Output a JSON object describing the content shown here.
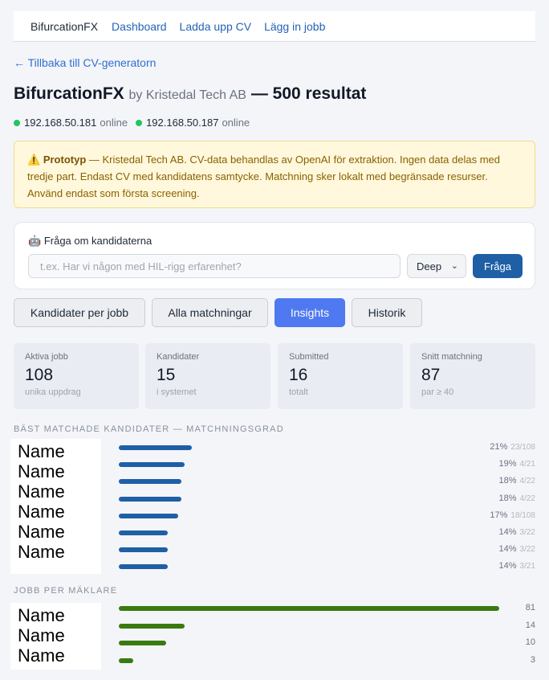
{
  "nav": {
    "brand": "BifurcationFX",
    "links": [
      "Dashboard",
      "Ladda upp CV",
      "Lägg in jobb"
    ]
  },
  "back_link": "← Tillbaka till CV-generatorn",
  "header": {
    "company": "BifurcationFX",
    "by": "by Kristedal Tech AB",
    "results": "— 500 resultat"
  },
  "servers": [
    {
      "host": "192.168.50.181",
      "state": "online"
    },
    {
      "host": "192.168.50.187",
      "state": "online"
    }
  ],
  "warning": {
    "icon": "warning-icon",
    "label": "Prototyp",
    "text": " — Kristedal Tech AB. CV-data behandlas av OpenAI för extraktion. Ingen data delas med tredje part. Endast CV med kandidatens samtycke. Matchning sker lokalt med begränsade resurser. Använd endast som första screening."
  },
  "ask": {
    "title": "Fråga om kandidaterna",
    "icon": "robot-icon",
    "placeholder": "t.ex. Har vi någon med HIL-rigg erfarenhet?",
    "mode": "Deep",
    "button": "Fråga"
  },
  "tabs": [
    {
      "label": "Kandidater per jobb",
      "active": false
    },
    {
      "label": "Alla matchningar",
      "active": false
    },
    {
      "label": "Insights",
      "active": true
    },
    {
      "label": "Historik",
      "active": false
    }
  ],
  "stats": [
    {
      "label": "Aktiva jobb",
      "value": "108",
      "sub": "unika uppdrag"
    },
    {
      "label": "Kandidater",
      "value": "15",
      "sub": "i systemet"
    },
    {
      "label": "Submitted",
      "value": "16",
      "sub": "totalt"
    },
    {
      "label": "Snitt matchning",
      "value": "87",
      "sub": "par ≥ 40"
    }
  ],
  "match_section": {
    "title": "BÄST MATCHADE KANDIDATER — MATCHNINGSGRAD",
    "names": [
      "Name",
      "Name",
      "Name",
      "Name",
      "Name",
      "Name"
    ],
    "rows": [
      {
        "pct": "21%",
        "frac": "23/108",
        "value": 21
      },
      {
        "pct": "19%",
        "frac": "4/21",
        "value": 19
      },
      {
        "pct": "18%",
        "frac": "4/22",
        "value": 18
      },
      {
        "pct": "18%",
        "frac": "4/22",
        "value": 18
      },
      {
        "pct": "17%",
        "frac": "18/108",
        "value": 17
      },
      {
        "pct": "14%",
        "frac": "3/22",
        "value": 14
      },
      {
        "pct": "14%",
        "frac": "3/22",
        "value": 14
      },
      {
        "pct": "14%",
        "frac": "3/21",
        "value": 14
      }
    ]
  },
  "broker_section": {
    "title": "JOBB PER MÄKLARE",
    "names": [
      "Name",
      "Name",
      "Name"
    ],
    "rows": [
      {
        "count": "81",
        "value": 81
      },
      {
        "count": "14",
        "value": 14
      },
      {
        "count": "10",
        "value": 10
      },
      {
        "count": "3",
        "value": 3
      }
    ]
  },
  "colors": {
    "match_bar": "#1f5fa6",
    "broker_bar": "#3a7a10",
    "active_tab": "#4e79f0",
    "online": "#22c55e"
  }
}
